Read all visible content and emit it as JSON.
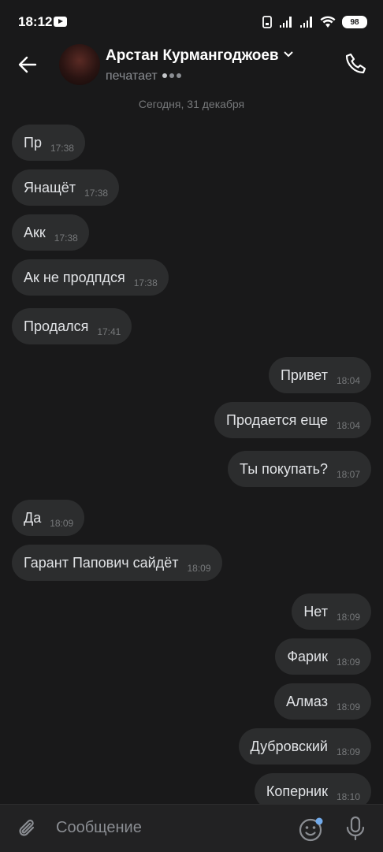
{
  "status_bar": {
    "time": "18:12",
    "battery": "98"
  },
  "header": {
    "contact_name": "Арстан Курмангоджоев",
    "status": "печатает"
  },
  "date_separator": "Сегодня, 31 декабря",
  "messages": [
    {
      "dir": "in",
      "text": "Пр",
      "time": "17:38"
    },
    {
      "dir": "in",
      "text": "Янащёт",
      "time": "17:38"
    },
    {
      "dir": "in",
      "text": "Акк",
      "time": "17:38"
    },
    {
      "dir": "in",
      "text": "Ак не продпдся",
      "time": "17:38"
    },
    {
      "dir": "in",
      "text": "Продался",
      "time": "17:41"
    },
    {
      "dir": "out",
      "text": "Привет",
      "time": "18:04"
    },
    {
      "dir": "out",
      "text": "Продается еще",
      "time": "18:04"
    },
    {
      "dir": "out",
      "text": "Ты покупать?",
      "time": "18:07"
    },
    {
      "dir": "in",
      "text": "Да",
      "time": "18:09"
    },
    {
      "dir": "in",
      "text": "Гарант Папович сайдёт",
      "time": "18:09"
    },
    {
      "dir": "out",
      "text": "Нет",
      "time": "18:09"
    },
    {
      "dir": "out",
      "text": "Фарик",
      "time": "18:09"
    },
    {
      "dir": "out",
      "text": "Алмаз",
      "time": "18:09"
    },
    {
      "dir": "out",
      "text": "Дубровский",
      "time": "18:09"
    },
    {
      "dir": "out",
      "text": "Коперник",
      "time": "18:10"
    }
  ],
  "composer": {
    "placeholder": "Сообщение"
  }
}
